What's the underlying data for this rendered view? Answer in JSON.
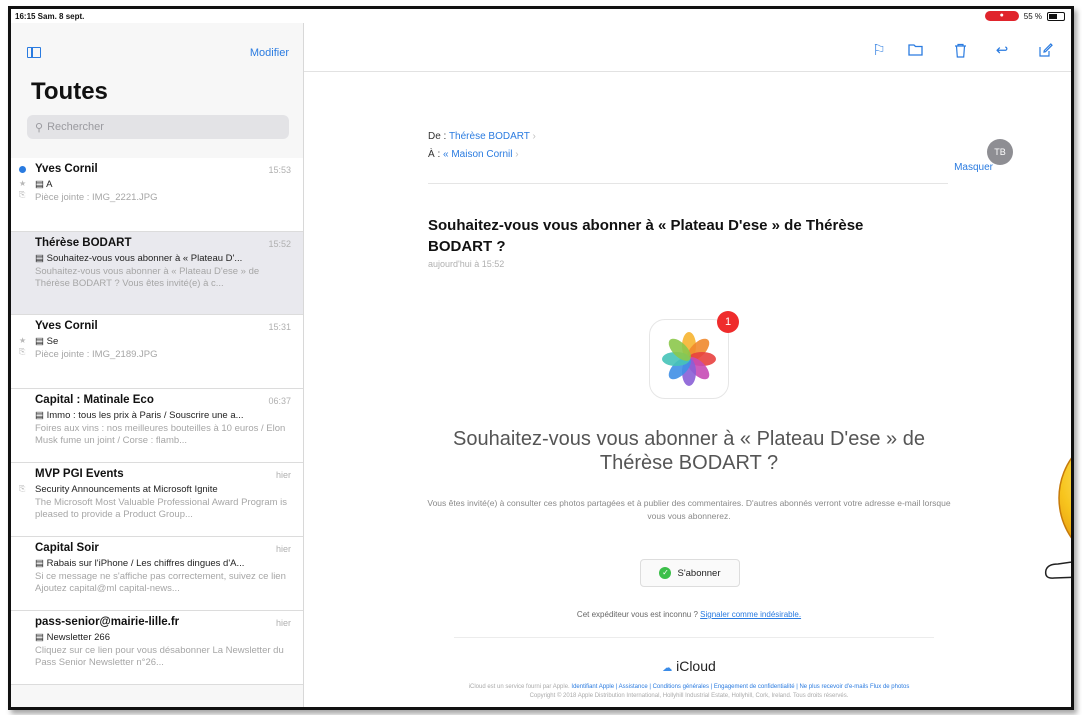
{
  "status_bar": {
    "time": "16:15 Sam. 8 sept.",
    "battery": "55 %"
  },
  "sidebar": {
    "edit_label": "Modifier",
    "title": "Toutes",
    "search_placeholder": "Rechercher",
    "mails": [
      {
        "sender": "Yves Cornil",
        "time": "15:53",
        "subject": "A",
        "preview": "Pièce jointe : IMG_2221.JPG",
        "unread": true
      },
      {
        "sender": "Thérèse BODART",
        "time": "15:52",
        "subject": "Souhaitez-vous vous abonner à « Plateau D'...",
        "preview": "Souhaitez-vous vous abonner à « Plateau D'ese » de Thérèse BODART ? Vous êtes invité(e) à c..."
      },
      {
        "sender": "Yves Cornil",
        "time": "15:31",
        "subject": "Se",
        "preview": "Pièce jointe : IMG_2189.JPG"
      },
      {
        "sender": "Capital : Matinale Eco",
        "time": "06:37",
        "subject": "Immo : tous les prix à Paris / Souscrire une a...",
        "preview": "Foires aux vins : nos meilleures bouteilles à 10 euros / Elon Musk fume un joint / Corse : flamb..."
      },
      {
        "sender": "MVP PGI Events",
        "time": "hier",
        "subject": "Security Announcements at Microsoft Ignite",
        "preview": "The Microsoft Most Valuable Professional Award Program is pleased to provide a Product Group..."
      },
      {
        "sender": "Capital Soir",
        "time": "hier",
        "subject": "Rabais sur l'iPhone / Les chiffres dingues d'A...",
        "preview": "Si ce message ne s'affiche pas correctement, suivez ce lien Ajoutez capital@ml capital-news..."
      },
      {
        "sender": "pass-senior@mairie-lille.fr",
        "time": "hier",
        "subject": "Newsletter 266",
        "preview": "Cliquez sur ce lien pour vous désabonner La Newsletter du Pass Senior Newsletter n°26..."
      }
    ]
  },
  "message": {
    "from_label": "De :",
    "from_name": "Thérèse BODART",
    "to_label": "À :",
    "to_name": "« Maison Cornil",
    "hide_label": "Masquer",
    "avatar_initials": "TB",
    "title": "Souhaitez-vous vous abonner à « Plateau D'ese » de Thérèse BODART ?",
    "date": "aujourd'hui à 15:52",
    "badge_count": "1",
    "body_headline": "Souhaitez-vous vous abonner à « Plateau D'ese » de Thérèse BODART ?",
    "body_text": "Vous êtes invité(e) à consulter ces photos partagées et à publier des commentaires. D'autres abonnés verront votre adresse e-mail lorsque vous vous abonnerez.",
    "subscribe_label": "S'abonner",
    "unknown_text": "Cet expéditeur vous est inconnu ?",
    "unknown_link": "Signaler comme indésirable.",
    "icloud_label": "iCloud",
    "legal_text": "iCloud est un service fourni par Apple.",
    "legal_links": "Identifiant Apple | Assistance | Conditions générales | Engagement de confidentialité | Ne plus recevoir d'e-mails Flux de photos",
    "copyright": "Copyright © 2018 Apple Distribution International, Hollyhill Industrial Estate, Hollyhill, Cork, Ireland. Tous droits réservés."
  },
  "colors": {
    "accent": "#2a7be0",
    "badge": "#ef2c2c",
    "check": "#3cbf4a"
  }
}
